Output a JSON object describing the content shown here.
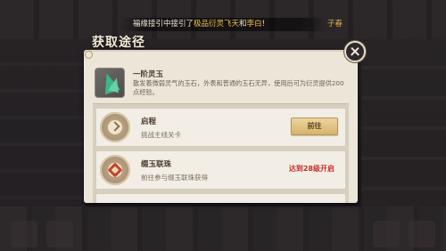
{
  "broadcast": {
    "prefix": "福缘接引中接引了",
    "highlight1": "极品衍灵",
    "mid": "飞天",
    "conj": "和",
    "highlight2": "李白",
    "suffix": "!",
    "tail": "子春"
  },
  "panel": {
    "title": "获取途径"
  },
  "item": {
    "name": "一阶灵玉",
    "description": "散发着微弱灵气的玉石，外表和普通的玉石无异，使用后可为衍灵提供200点经验。"
  },
  "sources": [
    {
      "title": "启程",
      "description": "挑战主线关卡",
      "action_label": "前往"
    },
    {
      "title": "缀玉联珠",
      "description": "前往参与缀玉联珠获得",
      "lock_text": "达到28级开启"
    }
  ],
  "colors": {
    "panel_bg": "#ece6d9",
    "button_gold": "#d6b46e",
    "lock_red": "#c2312a",
    "gem_green": "#3fb48a"
  },
  "icons": {
    "close": "close-icon",
    "item": "jade-gem-icon",
    "source1": "chevron-badge-icon",
    "source2": "knot-badge-icon"
  }
}
